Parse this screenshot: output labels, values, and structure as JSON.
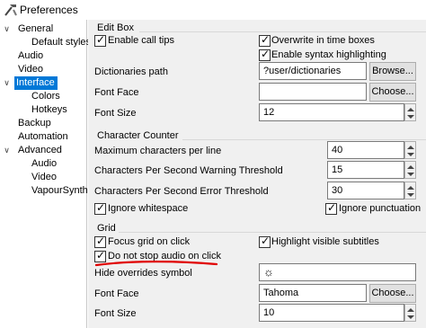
{
  "window": {
    "title": "Preferences"
  },
  "tree": {
    "items": [
      {
        "label": "General",
        "expandable": true
      },
      {
        "label": "Default styles"
      },
      {
        "label": "Audio"
      },
      {
        "label": "Video"
      },
      {
        "label": "Interface",
        "expandable": true,
        "selected": true
      },
      {
        "label": "Colors"
      },
      {
        "label": "Hotkeys"
      },
      {
        "label": "Backup"
      },
      {
        "label": "Automation"
      },
      {
        "label": "Advanced",
        "expandable": true
      },
      {
        "label": "Audio"
      },
      {
        "label": "Video"
      },
      {
        "label": "VapourSynth"
      }
    ]
  },
  "edit_box": {
    "title": "Edit Box",
    "enable_call_tips": {
      "label": "Enable call tips",
      "checked": true
    },
    "overwrite_time_boxes": {
      "label": "Overwrite in time boxes",
      "checked": true
    },
    "enable_syntax_highlighting": {
      "label": "Enable syntax highlighting",
      "checked": true
    },
    "dictionaries_path": {
      "label": "Dictionaries path",
      "value": "?user/dictionaries",
      "button": "Browse..."
    },
    "font_face": {
      "label": "Font Face",
      "value": "",
      "button": "Choose..."
    },
    "font_size": {
      "label": "Font Size",
      "value": "12"
    }
  },
  "character_counter": {
    "title": "Character Counter",
    "max_chars_per_line": {
      "label": "Maximum characters per line",
      "value": "40"
    },
    "cps_warning": {
      "label": "Characters Per Second Warning Threshold",
      "value": "15"
    },
    "cps_error": {
      "label": "Characters Per Second Error Threshold",
      "value": "30"
    },
    "ignore_whitespace": {
      "label": "Ignore whitespace",
      "checked": true
    },
    "ignore_punctuation": {
      "label": "Ignore punctuation",
      "checked": true
    }
  },
  "grid": {
    "title": "Grid",
    "focus_grid_on_click": {
      "label": "Focus grid on click",
      "checked": true
    },
    "highlight_visible_subtitles": {
      "label": "Highlight visible subtitles",
      "checked": true
    },
    "do_not_stop_audio": {
      "label": "Do not stop audio on click",
      "checked": true
    },
    "hide_overrides_symbol": {
      "label": "Hide overrides symbol",
      "value": "☼"
    },
    "font_face": {
      "label": "Font Face",
      "value": "Tahoma",
      "button": "Choose..."
    },
    "font_size": {
      "label": "Font Size",
      "value": "10"
    }
  },
  "colors": {
    "selection": "#0078d7",
    "annotation": "#e00000"
  }
}
